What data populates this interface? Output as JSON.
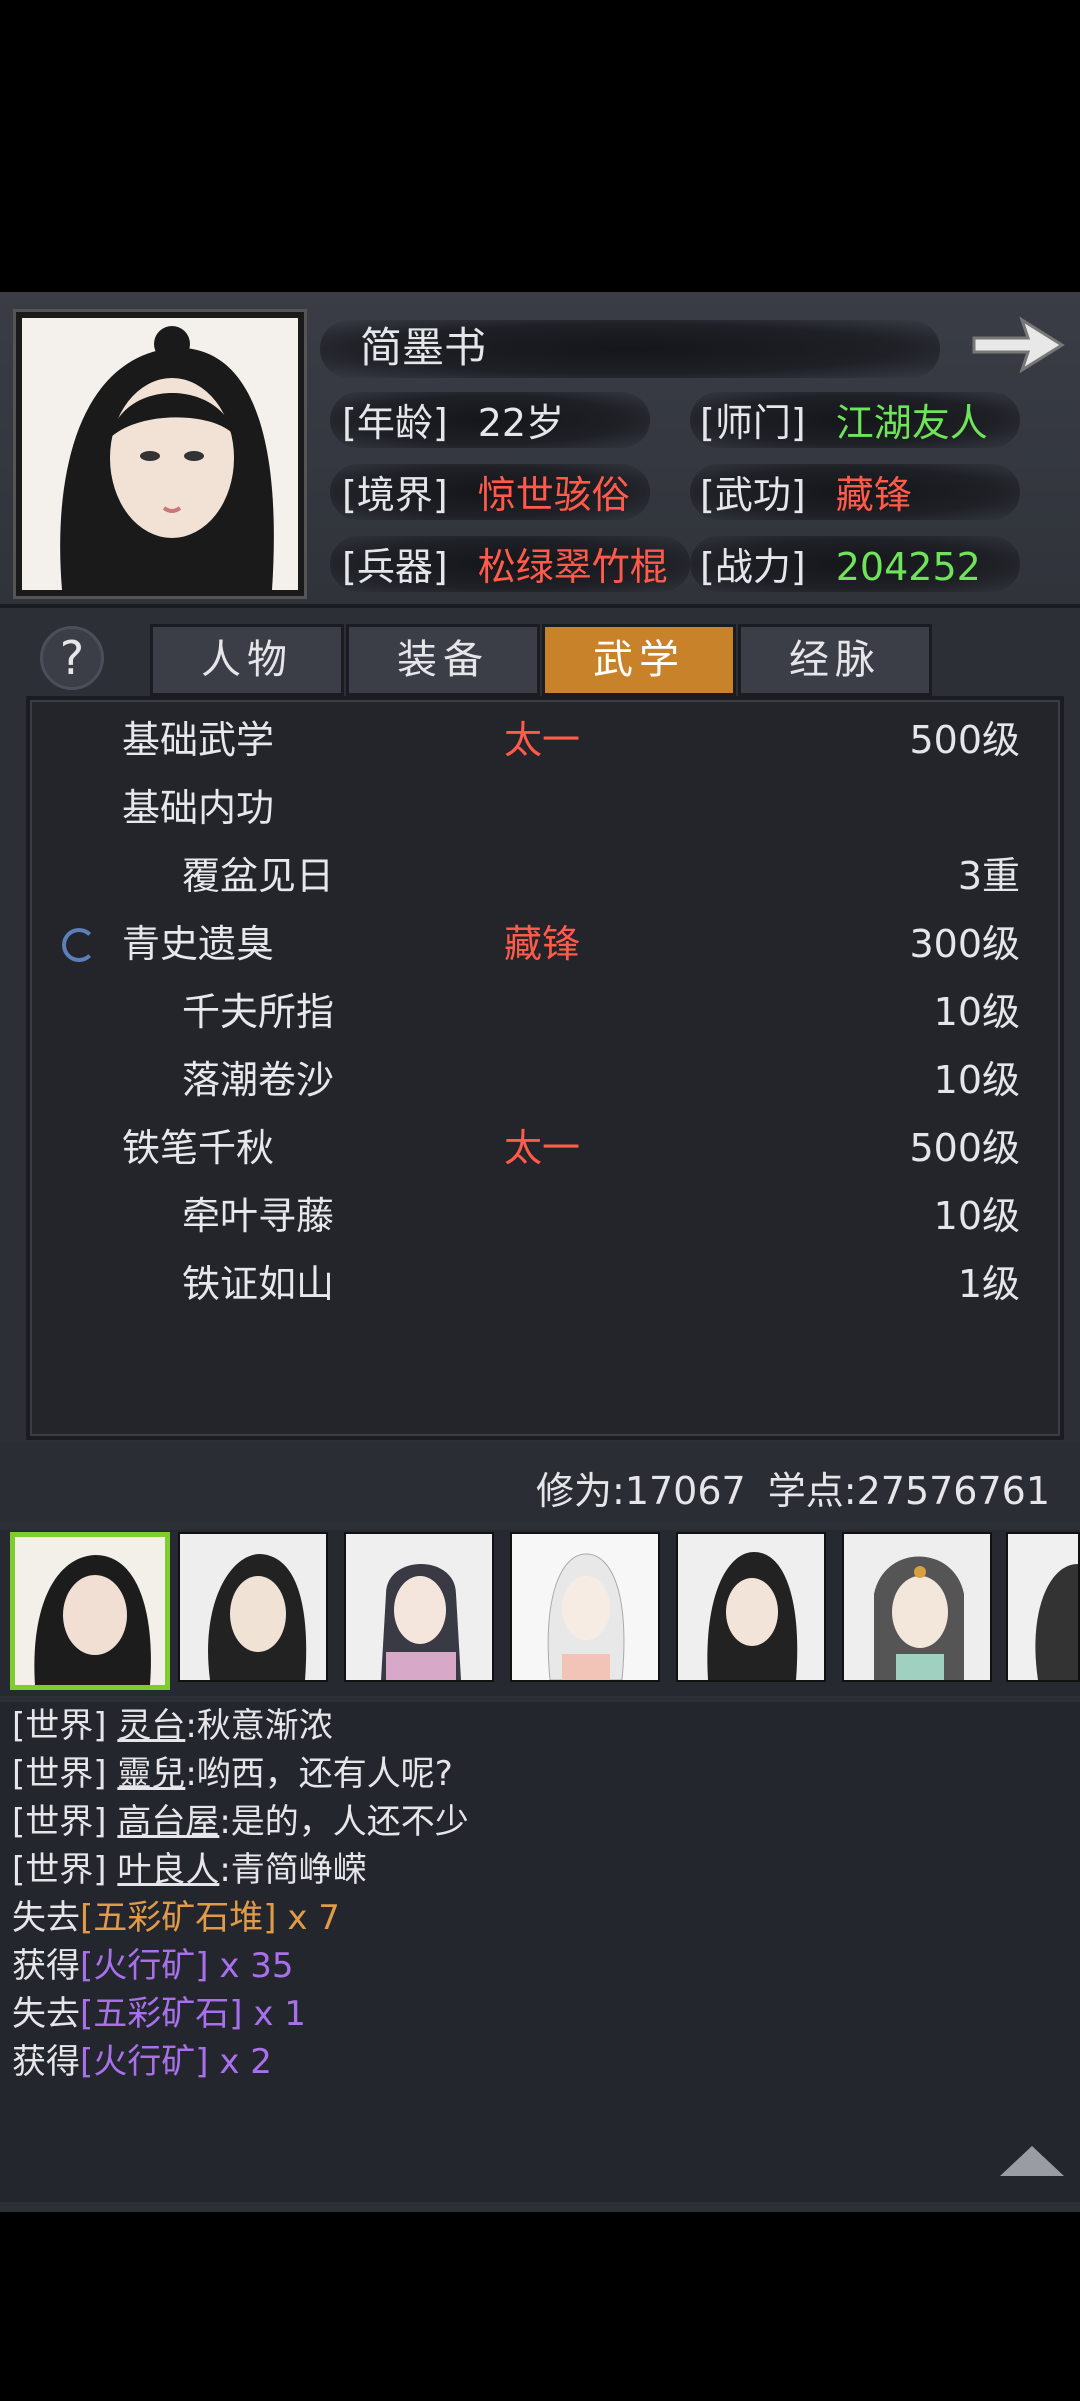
{
  "header": {
    "name": "简墨书",
    "rows": [
      {
        "l1": "[年龄]",
        "v1": "22岁",
        "l2": "[师门]",
        "v2": "江湖友人"
      },
      {
        "l1": "[境界]",
        "v1": "惊世骇俗",
        "l2": "[武功]",
        "v2": "藏锋"
      },
      {
        "l1": "[兵器]",
        "v1": "松绿翠竹棍",
        "l2": "[战力]",
        "v2": "204252"
      }
    ]
  },
  "help": "?",
  "tabs": [
    {
      "label": "人物"
    },
    {
      "label": "装备"
    },
    {
      "label": "武学"
    },
    {
      "label": "经脉"
    }
  ],
  "skills": [
    {
      "name": "基础武学",
      "style": "太一",
      "level": "500级"
    },
    {
      "name": "基础内功",
      "style": "",
      "level": ""
    },
    {
      "name": "覆盆见日",
      "style": "",
      "level": "3重"
    },
    {
      "name": "青史遗臭",
      "style": "藏锋",
      "level": "300级"
    },
    {
      "name": "千夫所指",
      "style": "",
      "level": "10级"
    },
    {
      "name": "落潮卷沙",
      "style": "",
      "level": "10级"
    },
    {
      "name": "铁笔千秋",
      "style": "太一",
      "level": "500级"
    },
    {
      "name": "牵叶寻藤",
      "style": "",
      "level": "10级"
    },
    {
      "name": "铁证如山",
      "style": "",
      "level": "1级"
    }
  ],
  "stats": "修为:17067 学点:27576761",
  "chat": [
    {
      "chan": "[世界]",
      "user": "灵台",
      "text": ":秋意渐浓"
    },
    {
      "chan": "[世界]",
      "user": "靈兒",
      "text": ":哟西，还有人呢?"
    },
    {
      "chan": "[世界]",
      "user": "高台屋",
      "text": ":是的，人还不少"
    },
    {
      "chan": "[世界]",
      "user": "叶良人",
      "text": ":青简峥嵘"
    },
    {
      "prefix": "失去",
      "item": "[五彩矿石堆]",
      "qty": " x 7"
    },
    {
      "prefix": "获得",
      "item": "[火行矿]",
      "qty": " x 35"
    },
    {
      "prefix": "失去",
      "item": "[五彩矿石]",
      "qty": " x 1"
    },
    {
      "prefix": "获得",
      "item": "[火行矿]",
      "qty": " x 2"
    }
  ],
  "colors": {
    "accent_tab": "#c8822a",
    "red": "#ff5a4a",
    "green": "#6fe45a",
    "purple": "#a870ea",
    "orange": "#e09a48"
  }
}
